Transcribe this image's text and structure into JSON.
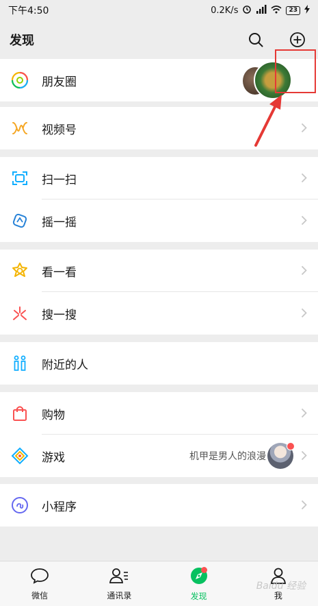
{
  "status": {
    "time": "下午4:50",
    "speed": "0.2K/s",
    "battery": "23"
  },
  "header": {
    "title": "发现",
    "search_icon": "search-icon",
    "add_icon": "plus-circle-icon"
  },
  "sections": [
    {
      "items": [
        {
          "label": "朋友圈",
          "icon": "moments-icon"
        }
      ]
    },
    {
      "items": [
        {
          "label": "视频号",
          "icon": "channels-icon"
        }
      ]
    },
    {
      "items": [
        {
          "label": "扫一扫",
          "icon": "scan-icon"
        },
        {
          "label": "摇一摇",
          "icon": "shake-icon"
        }
      ]
    },
    {
      "items": [
        {
          "label": "看一看",
          "icon": "top-stories-icon"
        },
        {
          "label": "搜一搜",
          "icon": "search-feature-icon"
        }
      ]
    },
    {
      "items": [
        {
          "label": "附近的人",
          "icon": "nearby-icon"
        }
      ]
    },
    {
      "items": [
        {
          "label": "购物",
          "icon": "shopping-icon"
        },
        {
          "label": "游戏",
          "icon": "games-icon",
          "subtitle": "机甲是男人的浪漫"
        }
      ]
    },
    {
      "items": [
        {
          "label": "小程序",
          "icon": "mini-programs-icon"
        }
      ]
    }
  ],
  "tabs": [
    {
      "label": "微信",
      "icon": "chat-icon"
    },
    {
      "label": "通讯录",
      "icon": "contacts-icon"
    },
    {
      "label": "发现",
      "icon": "discover-icon",
      "active": true
    },
    {
      "label": "我",
      "icon": "me-icon"
    }
  ],
  "watermark": "Baidu 经验",
  "colors": {
    "accent": "#07c160",
    "badge": "#fa5151",
    "annotation": "#e53935"
  }
}
